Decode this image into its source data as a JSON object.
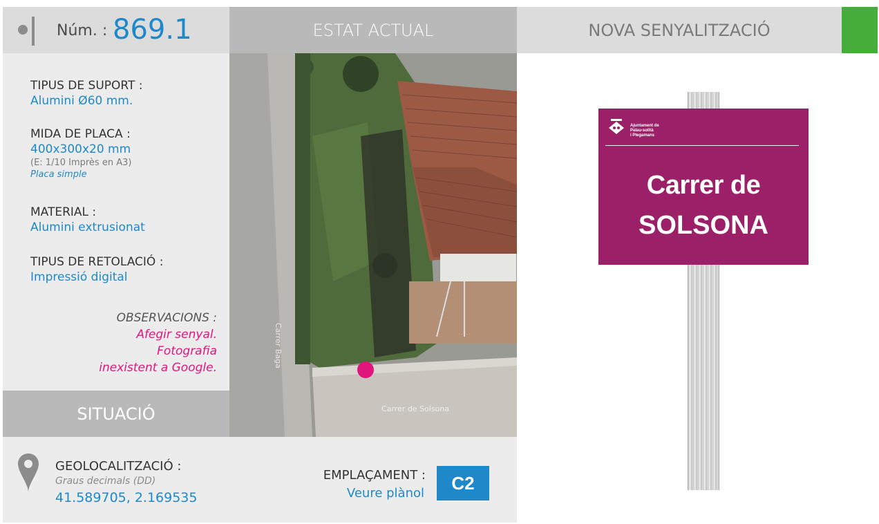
{
  "header": {
    "num_label": "Núm. :",
    "num_value": "869.1",
    "estat_title": "ESTAT ACTUAL",
    "nova_title": "NOVA SENYALITZACIÓ"
  },
  "fields": {
    "suport_label": "TIPUS DE SUPORT :",
    "suport_value": "Alumini Ø60 mm.",
    "mida_label": "MIDA DE PLACA :",
    "mida_value": "400x300x20 mm",
    "mida_note": "(E: 1/10 Imprès en A3)",
    "mida_note2": "Placa simple",
    "material_label": "MATERIAL :",
    "material_value": "Alumini extrusionat",
    "retolacio_label": "TIPUS DE RETOLACIÓ :",
    "retolacio_value": "Impressió digital"
  },
  "observations": {
    "label": "OBSERVACIONS :",
    "line1": "Afegir senyal.",
    "line2": "Fotografia",
    "line3": "inexistent a Google."
  },
  "situacio": "SITUACIÓ",
  "geo": {
    "label": "GEOLOCALITZACIÓ :",
    "sub": "Graus decimals (DD)",
    "value": "41.589705, 2.169535"
  },
  "emplacament": {
    "label": "EMPLAÇAMENT :",
    "link": "Veure plànol",
    "code": "C2"
  },
  "photo": {
    "street_label": "Carrer de Solsona",
    "street_label_vertical": "Carrer Baga"
  },
  "sign": {
    "municipality_line1": "Ajuntament de",
    "municipality_line2": "Palau-solità",
    "municipality_line3": "i Plegamans",
    "line1": "Carrer de",
    "line2": "SOLSONA"
  },
  "colors": {
    "accent_blue": "#1e88c8",
    "magenta": "#e0167c",
    "plate": "#9c2067",
    "green": "#46ad3b"
  }
}
